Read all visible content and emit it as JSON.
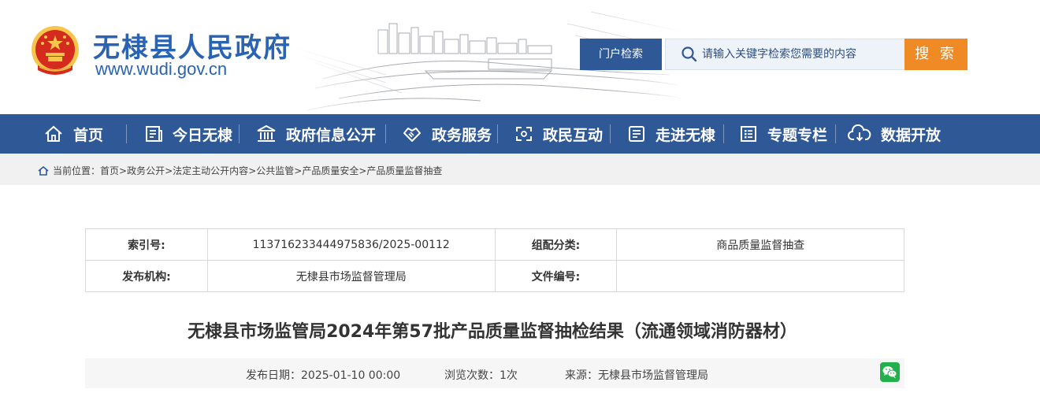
{
  "site": {
    "title": "无棣县人民政府",
    "url": "www.wudi.gov.cn"
  },
  "search": {
    "scope_label": "门户检索",
    "placeholder": "请输入关键字检索您需要的内容",
    "button_label": "搜 索"
  },
  "nav": {
    "items": [
      {
        "label": "首页",
        "icon": "home-icon"
      },
      {
        "label": "今日无棣",
        "icon": "newspaper-icon"
      },
      {
        "label": "政府信息公开",
        "icon": "government-building-icon"
      },
      {
        "label": "政务服务",
        "icon": "handshake-icon"
      },
      {
        "label": "政民互动",
        "icon": "interaction-icon"
      },
      {
        "label": "走进无棣",
        "icon": "document-list-icon"
      },
      {
        "label": "专题专栏",
        "icon": "checklist-icon"
      },
      {
        "label": "数据开放",
        "icon": "cloud-download-icon"
      }
    ]
  },
  "breadcrumb": {
    "prefix": "当前位置：",
    "items": [
      "首页",
      "政务公开",
      "法定主动公开内容",
      "公共监管",
      "产品质量安全",
      "产品质量监督抽查"
    ],
    "separator": ">"
  },
  "meta": {
    "index_label": "索引号:",
    "index_value": "113716233444975836/2025-00112",
    "category_label": "组配分类:",
    "category_value": "商品质量监督抽查",
    "publisher_label": "发布机构:",
    "publisher_value": "无棣县市场监督管理局",
    "doc_no_label": "文件编号:",
    "doc_no_value": ""
  },
  "article": {
    "title": "无棣县市场监管局2024年第57批产品质量监督抽检结果（流通领域消防器材）",
    "date_label": "发布日期：",
    "date_value": "2025-01-10 00:00",
    "views_label": "浏览次数：",
    "views_value": "1次",
    "source_label": "来源：",
    "source_value": "无棣县市场监督管理局"
  },
  "colors": {
    "brand_blue": "#2f5897",
    "title_blue": "#2a63b3",
    "search_orange": "#f08a24",
    "emblem_red": "#d52b1e",
    "emblem_gold": "#f6c64a",
    "wechat_green": "#21b04b"
  }
}
